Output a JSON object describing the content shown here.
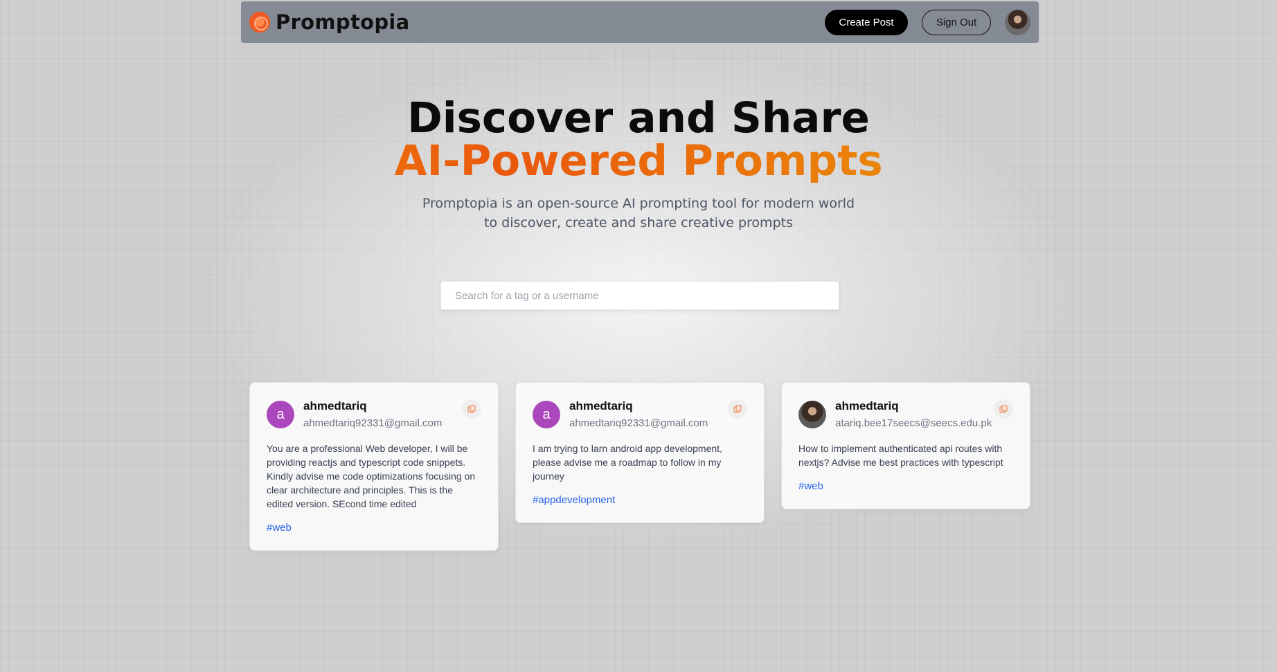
{
  "nav": {
    "brand": "Promptopia",
    "create_post_label": "Create Post",
    "sign_out_label": "Sign Out",
    "icons": {
      "logo": "promptopia-logo-icon",
      "avatar": "user-avatar"
    }
  },
  "hero": {
    "line1": "Discover and Share",
    "line2": "AI-Powered Prompts",
    "description": "Promptopia is an open-source AI prompting tool for modern world to discover, create and share creative prompts",
    "gradient_colors": [
      "#f59e0b",
      "#ea580c",
      "#eab308"
    ]
  },
  "search": {
    "placeholder": "Search for a tag or a username",
    "value": ""
  },
  "posts": [
    {
      "avatar_letter": "a",
      "username": "ahmedtariq",
      "email": "ahmedtariq92331@gmail.com",
      "prompt": "You are a professional Web developer, I will be providing reactjs and typescript code snippets. Kindly advise me code optimizations focusing on clear architecture and principles. This is the edited version. SEcond time edited",
      "tag": "#web"
    },
    {
      "avatar_letter": "a",
      "username": "ahmedtariq",
      "email": "ahmedtariq92331@gmail.com",
      "prompt": "I am trying to larn android app development, please advise me a roadmap to follow in my journey",
      "tag": "#appdevelopment"
    },
    {
      "avatar_letter": "",
      "username": "ahmedtariq",
      "email": "atariq.bee17seecs@seecs.edu.pk",
      "prompt": "How to implement authenticated api routes with nextjs? Advise me best practices with typescript",
      "tag": "#web"
    }
  ],
  "colors": {
    "accent": "#ea580c",
    "tag": "#2563eb",
    "avatar_bg": "#ab47bc",
    "navbar_bg": "#858b94"
  }
}
